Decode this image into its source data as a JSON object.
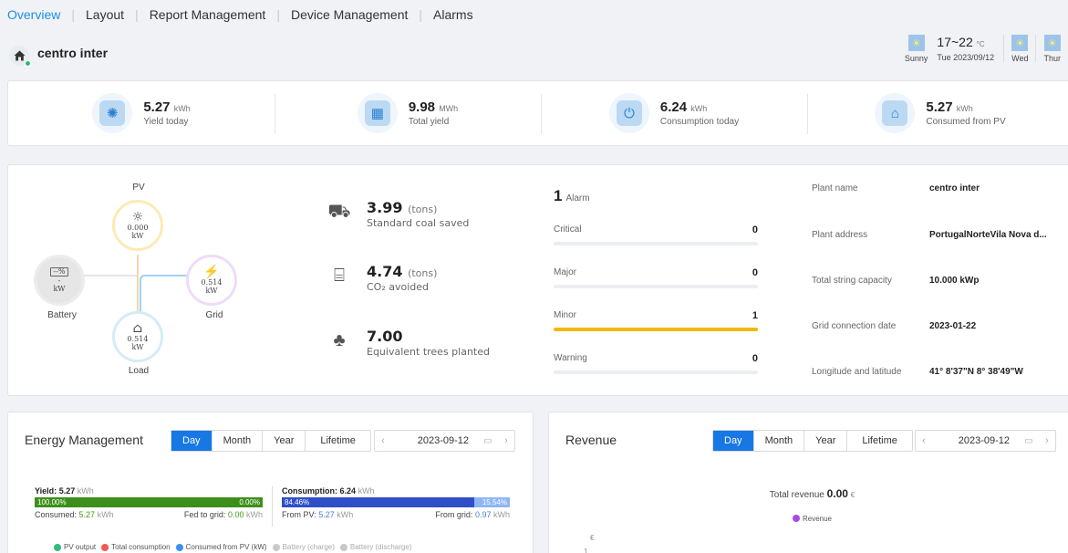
{
  "nav": {
    "items": [
      {
        "label": "Overview",
        "active": true
      },
      {
        "label": "Layout",
        "active": false
      },
      {
        "label": "Report Management",
        "active": false
      },
      {
        "label": "Device Management",
        "active": false
      },
      {
        "label": "Alarms",
        "active": false
      }
    ]
  },
  "plant": {
    "name": "centro inter"
  },
  "weather": {
    "today": {
      "condition": "Sunny",
      "temp_range": "17~22",
      "temp_unit": "°C",
      "date": "Tue 2023/09/12"
    },
    "forecast": [
      {
        "day": "Wed"
      },
      {
        "day": "Thur"
      }
    ]
  },
  "kpis": [
    {
      "value": "5.27",
      "unit": "kWh",
      "label": "Yield today",
      "icon": "sun-panel-icon"
    },
    {
      "value": "9.98",
      "unit": "MWh",
      "label": "Total yield",
      "icon": "solar-array-icon"
    },
    {
      "value": "6.24",
      "unit": "kWh",
      "label": "Consumption today",
      "icon": "plug-icon"
    },
    {
      "value": "5.27",
      "unit": "kWh",
      "label": "Consumed from PV",
      "icon": "pv-house-icon"
    }
  ],
  "flow": {
    "pv": {
      "label": "PV",
      "value": "0.000",
      "unit": "kW"
    },
    "battery": {
      "label": "Battery",
      "value": "-",
      "unit": "kW",
      "soc": "--%"
    },
    "grid": {
      "label": "Grid",
      "value": "0.514",
      "unit": "kW"
    },
    "load": {
      "label": "Load",
      "value": "0.514",
      "unit": "kW"
    }
  },
  "environment": [
    {
      "value": "3.99",
      "unit": "(tons)",
      "label": "Standard coal saved",
      "icon": "coal-cart-icon"
    },
    {
      "value": "4.74",
      "unit": "(tons)",
      "label": "CO₂ avoided",
      "icon": "factory-icon"
    },
    {
      "value": "7.00",
      "unit": "",
      "label": "Equivalent trees planted",
      "icon": "tree-icon"
    }
  ],
  "alarms": {
    "total": "1",
    "total_label": "Alarm",
    "levels": [
      {
        "label": "Critical",
        "count": "0",
        "fill": 0
      },
      {
        "label": "Major",
        "count": "0",
        "fill": 0
      },
      {
        "label": "Minor",
        "count": "1",
        "fill": 1
      },
      {
        "label": "Warning",
        "count": "0",
        "fill": 0
      }
    ],
    "fill_color": "#f5b800"
  },
  "info": [
    {
      "label": "Plant name",
      "value": "centro inter"
    },
    {
      "label": "Plant address",
      "value": "PortugalNorteVila Nova d..."
    },
    {
      "label": "Total string capacity",
      "value": "10.000 kWp"
    },
    {
      "label": "Grid connection date",
      "value": "2023-01-22"
    },
    {
      "label": "Longitude and latitude",
      "value": "41° 8'37\"N   8° 38'49\"W"
    }
  ],
  "energy": {
    "title": "Energy Management",
    "tabs": [
      "Day",
      "Month",
      "Year",
      "Lifetime"
    ],
    "active_tab": "Day",
    "date": "2023-09-12",
    "yield": {
      "title": "Yield:",
      "value": "5.27",
      "unit": "kWh",
      "left_pct": "100.00%",
      "right_pct": "0.00%",
      "consumed_label": "Consumed:",
      "consumed_value": "5.27",
      "consumed_unit": "kWh",
      "fed_label": "Fed to grid:",
      "fed_value": "0.00",
      "fed_unit": "kWh",
      "share": 1.0
    },
    "consumption": {
      "title": "Consumption:",
      "value": "6.24",
      "unit": "kWh",
      "left_pct": "84.46%",
      "right_pct": "15.54%",
      "from_pv_label": "From PV:",
      "from_pv_value": "5.27",
      "from_pv_unit": "kWh",
      "from_grid_label": "From grid:",
      "from_grid_value": "0.97",
      "from_grid_unit": "kWh",
      "share": 0.8446
    },
    "legend": [
      {
        "label": "PV output",
        "color": "#2ebd7a",
        "dim": false
      },
      {
        "label": "Total consumption",
        "color": "#ef5a52",
        "dim": false
      },
      {
        "label": "Consumed from PV (kW)",
        "color": "#3b8ff0",
        "dim": false
      },
      {
        "label": "Battery (charge)",
        "color": "#c8c8c8",
        "dim": true
      },
      {
        "label": "Battery (discharge)",
        "color": "#c8c8c8",
        "dim": true
      }
    ]
  },
  "revenue": {
    "title": "Revenue",
    "tabs": [
      "Day",
      "Month",
      "Year",
      "Lifetime"
    ],
    "active_tab": "Day",
    "date": "2023-09-12",
    "total_label": "Total revenue",
    "total_value": "0.00",
    "currency": "€",
    "legend_label": "Revenue",
    "axis_unit": "€",
    "axis_tick": "1"
  }
}
